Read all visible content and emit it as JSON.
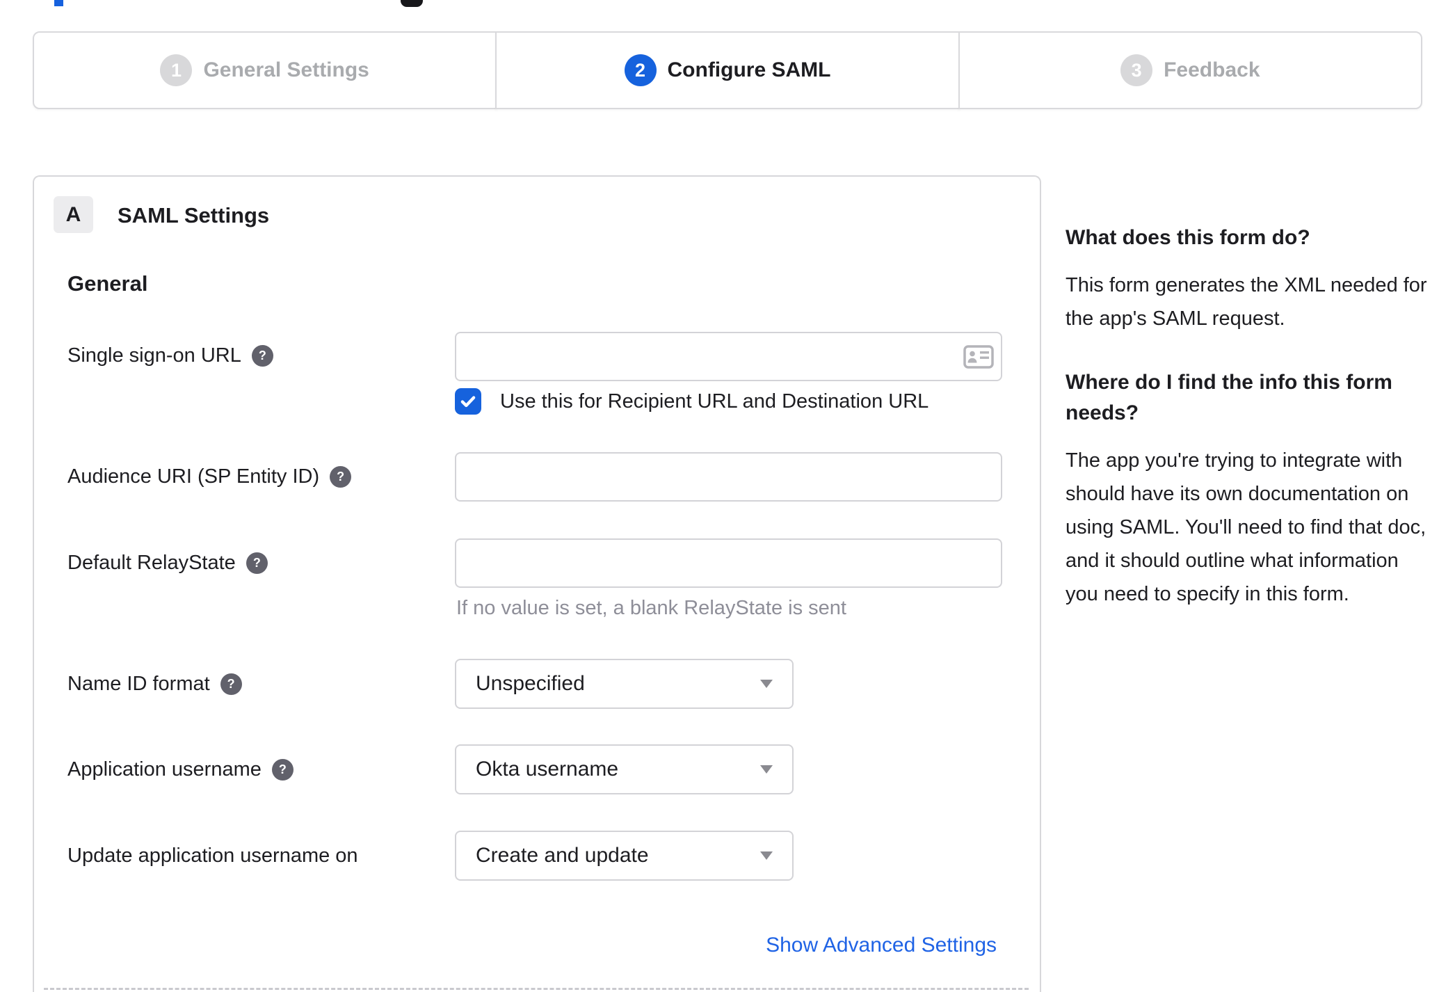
{
  "colors": {
    "accent_blue": "#1662dd",
    "link_blue": "#1f63e5",
    "inactive_gray": "#a9abae",
    "border_gray": "#d7d7da",
    "hint_gray": "#8e8e98",
    "help_icon_gray": "#61616b"
  },
  "icons": {
    "help_glyph": "?"
  },
  "stepper": {
    "steps": [
      {
        "number": "1",
        "label": "General Settings",
        "state": "inactive"
      },
      {
        "number": "2",
        "label": "Configure SAML",
        "state": "active"
      },
      {
        "number": "3",
        "label": "Feedback",
        "state": "inactive"
      }
    ]
  },
  "panel": {
    "section_badge": "A",
    "section_title": "SAML Settings",
    "group_title": "General"
  },
  "form": {
    "sso": {
      "label": "Single sign-on URL",
      "value": "",
      "checkbox_label": "Use this for Recipient URL and Destination URL",
      "checkbox_checked": true
    },
    "audience": {
      "label": "Audience URI (SP Entity ID)",
      "value": ""
    },
    "relaystate": {
      "label": "Default RelayState",
      "value": "",
      "hint": "If no value is set, a blank RelayState is sent"
    },
    "name_id_format": {
      "label": "Name ID format",
      "value": "Unspecified"
    },
    "application_username": {
      "label": "Application username",
      "value": "Okta username"
    },
    "update_application_username": {
      "label": "Update application username on",
      "value": "Create and update"
    },
    "advanced_link_label": "Show Advanced Settings"
  },
  "sidebar": {
    "sections": [
      {
        "heading": "What does this form do?",
        "body": "This form generates the XML needed for the app's SAML request."
      },
      {
        "heading": "Where do I find the info this form needs?",
        "body": "The app you're trying to integrate with should have its own documentation on using SAML. You'll need to find that doc, and it should outline what information you need to specify in this form."
      }
    ]
  }
}
